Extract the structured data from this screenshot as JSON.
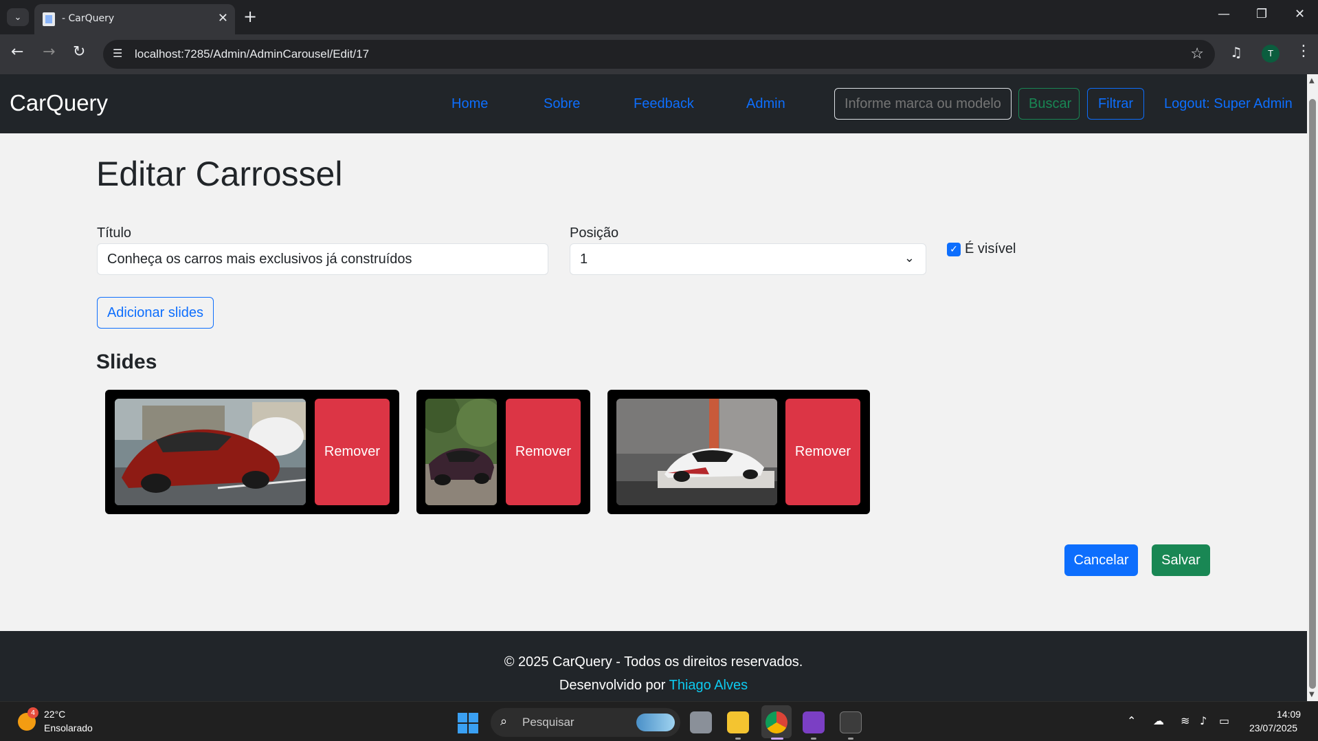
{
  "browser": {
    "tab_title": "- CarQuery",
    "url": "localhost:7285/Admin/AdminCarousel/Edit/17"
  },
  "navbar": {
    "brand": "CarQuery",
    "links": [
      "Home",
      "Sobre",
      "Feedback",
      "Admin"
    ],
    "search_placeholder": "Informe marca ou modelo",
    "buscar_label": "Buscar",
    "filtrar_label": "Filtrar",
    "logout_label": "Logout: Super Admin"
  },
  "form": {
    "page_title": "Editar Carrossel",
    "titulo_label": "Título",
    "titulo_value": "Conheça os carros mais exclusivos já construídos",
    "posicao_label": "Posição",
    "posicao_value": "1",
    "visivel_label": "É visível",
    "visivel_checked": true,
    "add_slides_label": "Adicionar slides",
    "slides_heading": "Slides",
    "remove_label": "Remover",
    "slides": [
      {
        "image": "red-supercar-street"
      },
      {
        "image": "dark-hypercar-trees"
      },
      {
        "image": "white-hypercar-showroom"
      }
    ],
    "cancel_label": "Cancelar",
    "save_label": "Salvar"
  },
  "footer": {
    "copyright": "© 2025 CarQuery - Todos os direitos reservados.",
    "developed_by": "Desenvolvido por",
    "author": "Thiago Alves"
  },
  "taskbar": {
    "weather_badge": "4",
    "temperature": "22°C",
    "weather": "Ensolarado",
    "search_label": "Pesquisar",
    "time": "14:09",
    "date": "23/07/2025"
  },
  "colors": {
    "primary": "#0d6efd",
    "success": "#198754",
    "danger": "#dc3545",
    "dark": "#212529"
  }
}
